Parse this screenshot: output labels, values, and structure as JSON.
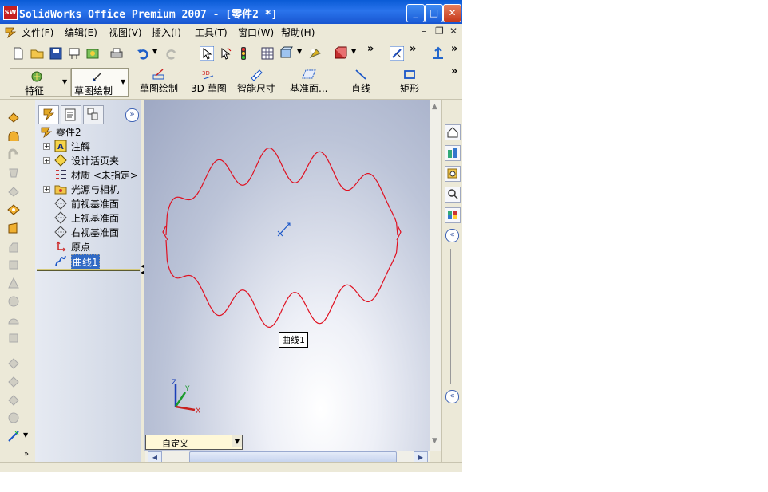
{
  "window": {
    "title": "SolidWorks Office Premium 2007 - [零件2 *]",
    "app_icon": "solidworks-logo-icon",
    "minimize_glyph": "_",
    "maximize_glyph": "□",
    "close_glyph": "✕"
  },
  "menu": {
    "items": [
      "文件(F)",
      "编辑(E)",
      "视图(V)",
      "插入(I)",
      "工具(T)",
      "窗口(W)",
      "帮助(H)"
    ],
    "mdi_minimize": "–",
    "mdi_restore": "❐",
    "mdi_close": "✕"
  },
  "standard_toolbar": {
    "icons": [
      "new-icon",
      "open-icon",
      "save-icon",
      "print-preview-icon",
      "options-icon",
      "print-icon",
      "undo-icon",
      "redo-icon",
      "select-icon",
      "select-other-icon",
      "rebuild-icon",
      "grid-icon",
      "view-orientation-icon",
      "lights-icon",
      "display-style-icon",
      "more-icon",
      "hide-show-icon",
      "normal-to-icon"
    ],
    "overflow": "»"
  },
  "commandmanager": {
    "features_label": "特征",
    "sketch_label": "草图绘制",
    "commands": [
      {
        "label": "草图绘制",
        "icon": "sketch-icon"
      },
      {
        "label": "3D 草图",
        "icon": "3d-sketch-icon"
      },
      {
        "label": "智能尺寸",
        "icon": "smart-dimension-icon"
      },
      {
        "label": "基准面...",
        "icon": "plane-icon"
      },
      {
        "label": "直线",
        "icon": "line-icon"
      },
      {
        "label": "矩形",
        "icon": "rectangle-icon"
      }
    ],
    "overflow": "»"
  },
  "feature_tree": {
    "root": "零件2",
    "expand_glyph": "»",
    "items": [
      {
        "label": "注解",
        "icon": "annotations-icon",
        "expandable": true
      },
      {
        "label": "设计活页夹",
        "icon": "design-binder-icon",
        "expandable": true
      },
      {
        "label": "材质 <未指定>",
        "icon": "material-icon",
        "expandable": false
      },
      {
        "label": "光源与相机",
        "icon": "lights-cameras-icon",
        "expandable": true
      },
      {
        "label": "前视基准面",
        "icon": "front-plane-icon",
        "expandable": false
      },
      {
        "label": "上视基准面",
        "icon": "top-plane-icon",
        "expandable": false
      },
      {
        "label": "右视基准面",
        "icon": "right-plane-icon",
        "expandable": false
      },
      {
        "label": "原点",
        "icon": "origin-icon",
        "expandable": false
      },
      {
        "label": "曲线1",
        "icon": "curve-icon",
        "expandable": false,
        "selected": true
      }
    ]
  },
  "viewport": {
    "tooltip": "曲线1",
    "triad": {
      "x": "X",
      "y": "Y",
      "z": "Z"
    },
    "curve_color": "#e01020"
  },
  "configuration": {
    "value": "自定义"
  },
  "task_pane": {
    "collapse_glyph": "«"
  },
  "colors": {
    "title_blue": "#1f62dd",
    "selection_blue": "#316ac5"
  }
}
